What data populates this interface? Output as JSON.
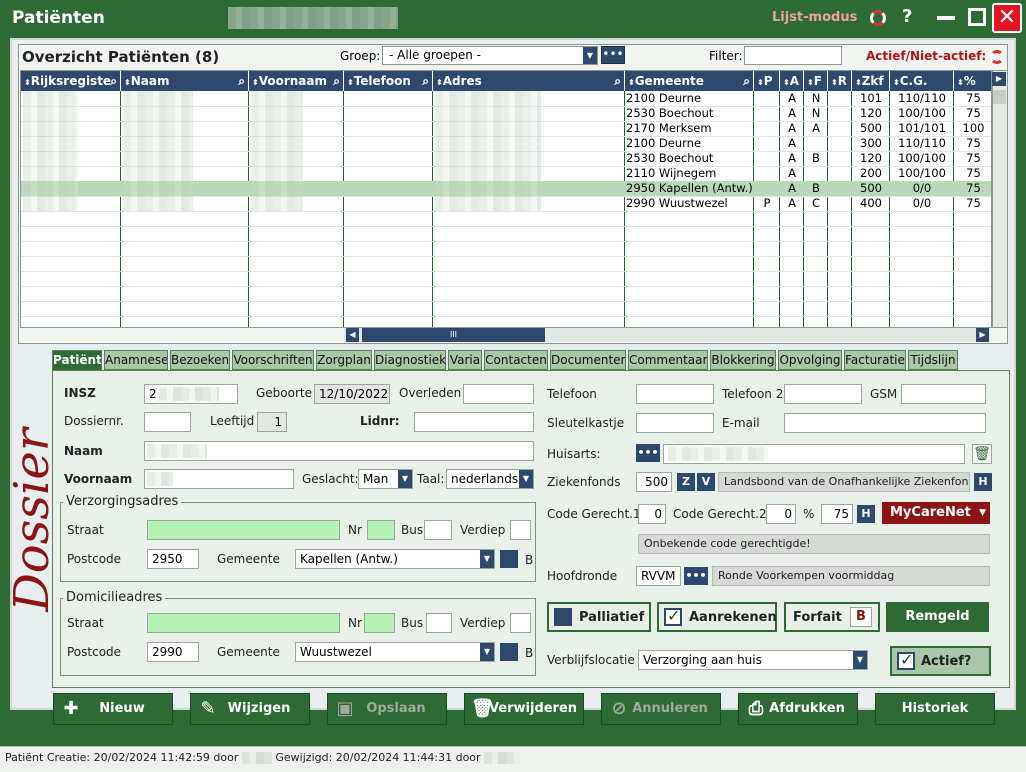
{
  "window": {
    "title": "Patiënten",
    "mode_label": "Lijst-modus",
    "help_label": "?",
    "close_label": "✕"
  },
  "overview": {
    "title": "Overzicht Patiënten (8)",
    "group_label": "Groep:",
    "group_value": "- Alle groepen -",
    "more_label": "•••",
    "filter_label": "Filter:",
    "active_toggle": "Actief/Niet-actief:"
  },
  "grid": {
    "columns": [
      "Rijksregiste",
      "Naam",
      "Voornaam",
      "Telefoon",
      "Adres",
      "Gemeente",
      "P",
      "A",
      "F",
      "R",
      "Zkf",
      "C.G.",
      "%"
    ],
    "rows": [
      {
        "gemeente": "2100 Deurne",
        "p": "",
        "a": "A",
        "f": "N",
        "r": "",
        "zkf": "101",
        "cg": "110/110",
        "pct": "75"
      },
      {
        "gemeente": "2530 Boechout",
        "p": "",
        "a": "A",
        "f": "N",
        "r": "",
        "zkf": "120",
        "cg": "100/100",
        "pct": "75"
      },
      {
        "gemeente": "2170 Merksem",
        "p": "",
        "a": "A",
        "f": "A",
        "r": "",
        "zkf": "500",
        "cg": "101/101",
        "pct": "100"
      },
      {
        "gemeente": "2100 Deurne",
        "p": "",
        "a": "A",
        "f": "",
        "r": "",
        "zkf": "300",
        "cg": "110/110",
        "pct": "75"
      },
      {
        "gemeente": "2530 Boechout",
        "p": "",
        "a": "A",
        "f": "B",
        "r": "",
        "zkf": "120",
        "cg": "100/100",
        "pct": "75"
      },
      {
        "gemeente": "2110 Wijnegem",
        "p": "",
        "a": "A",
        "f": "",
        "r": "",
        "zkf": "200",
        "cg": "100/100",
        "pct": "75"
      },
      {
        "gemeente": "2950 Kapellen (Antw.)",
        "p": "",
        "a": "A",
        "f": "B",
        "r": "",
        "zkf": "500",
        "cg": "0/0",
        "pct": "75",
        "selected": true
      },
      {
        "gemeente": "2990 Wuustwezel",
        "p": "P",
        "a": "A",
        "f": "C",
        "r": "",
        "zkf": "400",
        "cg": "0/0",
        "pct": "75"
      }
    ],
    "hscroll_thumb": "III"
  },
  "side_label": "Dossier",
  "tabs": [
    "Patiënt",
    "Anamnese",
    "Bezoeken",
    "Voorschriften",
    "Zorgplan",
    "Diagnostiek",
    "Varia",
    "Contacten",
    "Documenten",
    "Commentaar",
    "Blokkering",
    "Opvolging",
    "Facturatie",
    "Tijdslijn"
  ],
  "patient": {
    "insz_label": "INSZ",
    "insz_value": "2",
    "geboorte_label": "Geboorte",
    "geboorte_value": "12/10/2022",
    "overleden_label": "Overleden",
    "dossiernr_label": "Dossiernr.",
    "leeftijd_label": "Leeftijd",
    "leeftijd_value": "1",
    "lidnr_label": "Lidnr:",
    "naam_label": "Naam",
    "voornaam_label": "Voornaam",
    "geslacht_label": "Geslacht:",
    "geslacht_value": "Man",
    "taal_label": "Taal:",
    "taal_value": "nederlands",
    "verzorging": {
      "legend": "Verzorgingsadres",
      "straat_label": "Straat",
      "nr_label": "Nr",
      "bus_label": "Bus",
      "verdiep_label": "Verdiep",
      "postcode_label": "Postcode",
      "postcode_value": "2950",
      "gemeente_label": "Gemeente",
      "gemeente_value": "Kapellen (Antw.)",
      "b_label": "B"
    },
    "domicilie": {
      "legend": "Domicilieadres",
      "straat_label": "Straat",
      "nr_label": "Nr",
      "bus_label": "Bus",
      "verdiep_label": "Verdiep",
      "postcode_label": "Postcode",
      "postcode_value": "2990",
      "gemeente_label": "Gemeente",
      "gemeente_value": "Wuustwezel",
      "b_label": "B"
    },
    "telefoon_label": "Telefoon",
    "telefoon2_label": "Telefoon 2",
    "gsm_label": "GSM",
    "sleutelkastje_label": "Sleutelkastje",
    "email_label": "E-mail",
    "huisarts_label": "Huisarts:",
    "ziekenfonds_label": "Ziekenfonds",
    "ziekenfonds_value": "500",
    "ziekenfonds_z": "Z",
    "ziekenfonds_v": "V",
    "ziekenfonds_name": "Landsbond van de Onafhankelijke Ziekenfondsen",
    "h_label": "H",
    "codeg1_label": "Code Gerecht.1",
    "codeg1_value": "0",
    "codeg2_label": "Code Gerecht.2",
    "codeg2_value": "0",
    "pct_label": "%",
    "pct_value": "75",
    "mycarenet_label": "MyCareNet",
    "code_info": "Onbekende code gerechtigde!",
    "hoofdronde_label": "Hoofdronde",
    "hoofdronde_value": "RVVM",
    "hoofdronde_name": "Ronde Voorkempen voormiddag",
    "palliatief_label": "Palliatief",
    "aanrekenen_label": "Aanrekenen",
    "forfait_label": "Forfait",
    "forfait_value": "B",
    "remgeld_label": "Remgeld",
    "verblijf_label": "Verblijfslocatie",
    "verblijf_value": "Verzorging aan huis",
    "actief_label": "Actief?"
  },
  "buttons": {
    "nieuw": "Nieuw",
    "wijzigen": "Wijzigen",
    "opslaan": "Opslaan",
    "verwijderen": "Verwijderen",
    "annuleren": "Annuleren",
    "afdrukken": "Afdrukken",
    "historiek": "Historiek"
  },
  "status": {
    "prefix": "Patiënt",
    "creatie": "Creatie: 20/02/2024 11:42:59 door",
    "gewijzigd": "Gewijzigd: 20/02/2024 11:44:31 door"
  }
}
